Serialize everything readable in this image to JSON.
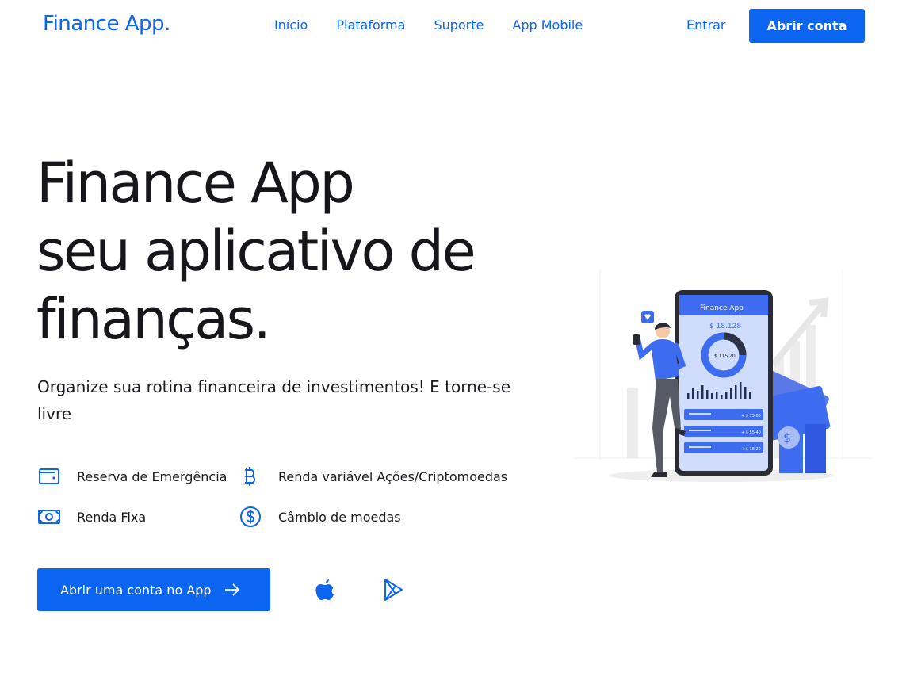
{
  "header": {
    "logo": "Finance App.",
    "nav": [
      "Início",
      "Plataforma",
      "Suporte",
      "App Mobile"
    ],
    "login": "Entrar",
    "open_account": "Abrir conta"
  },
  "hero": {
    "title_lines": [
      "Finance App",
      "seu aplicativo de",
      "finanças."
    ],
    "subtitle": "Organize sua rotina financeira de investimentos! E torne-se livre",
    "features": [
      {
        "label": "Reserva de Emergência",
        "icon": "wallet-icon"
      },
      {
        "label": "Renda variável Ações/Criptomoedas",
        "icon": "bitcoin-icon"
      },
      {
        "label": "Renda Fixa",
        "icon": "banknote-icon"
      },
      {
        "label": "Câmbio de moedas",
        "icon": "dollar-circle-icon"
      }
    ],
    "cta": "Abrir uma conta no App",
    "stores": [
      "apple-icon",
      "google-play-icon"
    ]
  },
  "phone": {
    "app_title": "Finance App",
    "balance": "$ 18.128",
    "donut_value": "$ 115.20",
    "rows": [
      "+ $ 75,00",
      "+ $ 55,40",
      "+ $ 18,20"
    ]
  },
  "colors": {
    "accent": "#0b65f0",
    "text": "#16161b",
    "illustration_blue": "#3d6cf0"
  }
}
